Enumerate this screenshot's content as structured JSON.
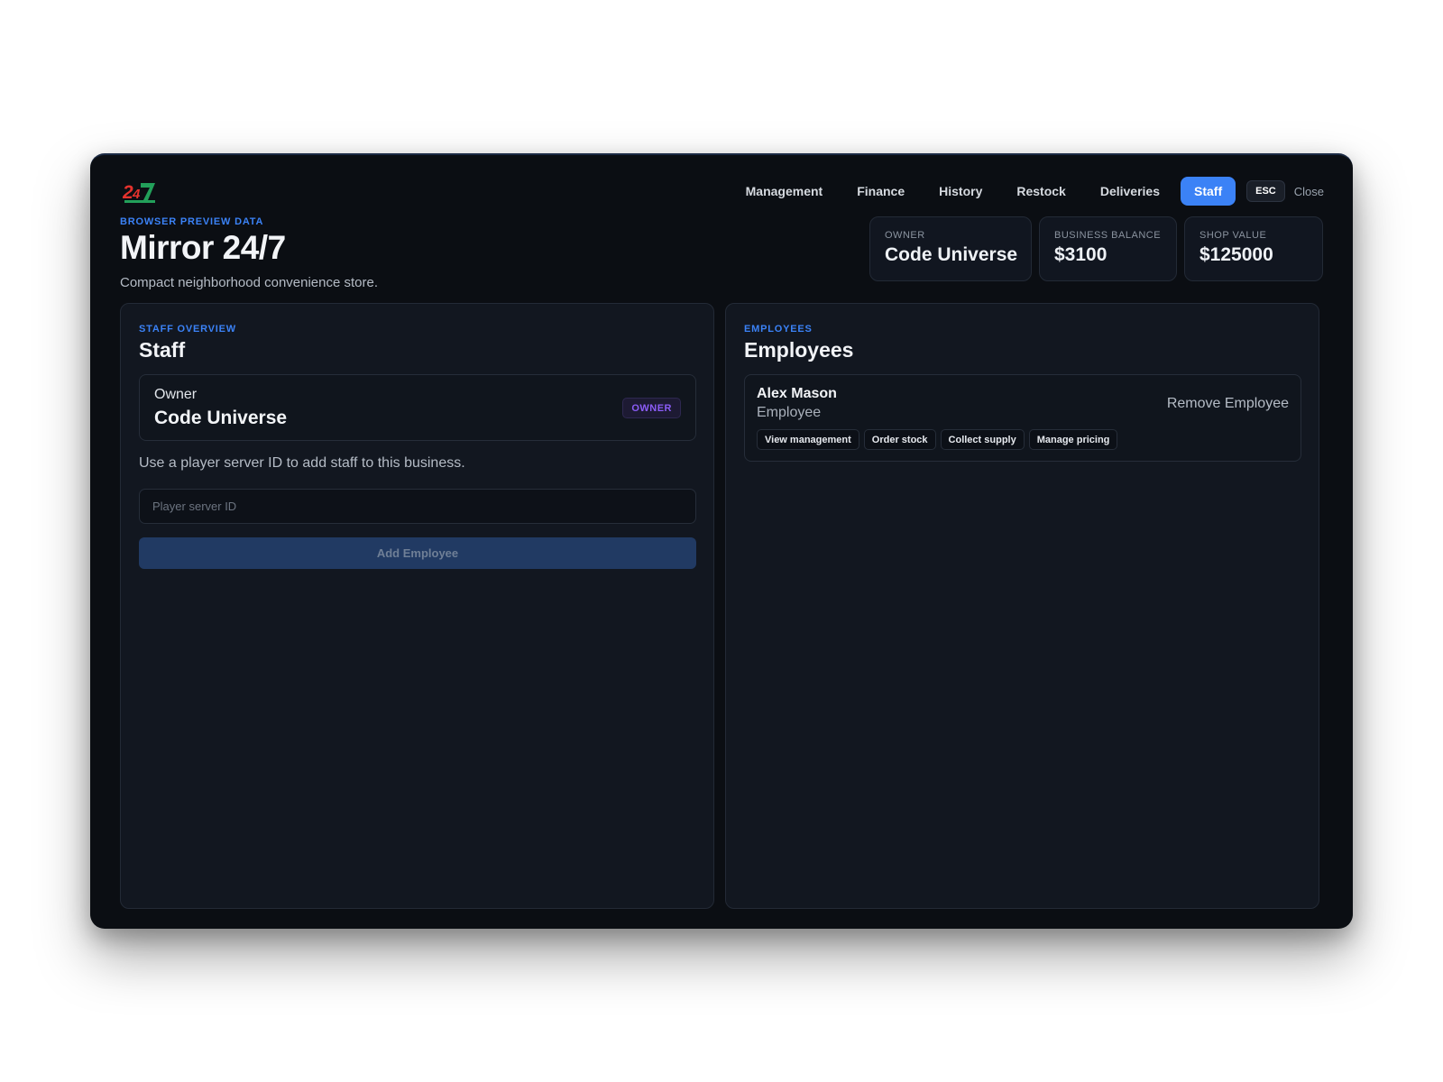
{
  "nav": {
    "tabs": [
      {
        "label": "Management",
        "active": false
      },
      {
        "label": "Finance",
        "active": false
      },
      {
        "label": "History",
        "active": false
      },
      {
        "label": "Restock",
        "active": false
      },
      {
        "label": "Deliveries",
        "active": false
      },
      {
        "label": "Staff",
        "active": true
      }
    ],
    "esc_label": "ESC",
    "close_label": "Close"
  },
  "header": {
    "eyebrow": "BROWSER PREVIEW DATA",
    "title": "Mirror 24/7",
    "subtitle": "Compact neighborhood convenience store."
  },
  "stats": {
    "owner": {
      "label": "OWNER",
      "value": "Code Universe"
    },
    "balance": {
      "label": "BUSINESS BALANCE",
      "value": "$3100"
    },
    "shop_value": {
      "label": "SHOP VALUE",
      "value": "$125000"
    }
  },
  "staff_panel": {
    "eyebrow": "STAFF OVERVIEW",
    "title": "Staff",
    "owner_card": {
      "role": "Owner",
      "name": "Code Universe",
      "badge": "OWNER"
    },
    "helper_text": "Use a player server ID to add staff to this business.",
    "input_placeholder": "Player server ID",
    "input_value": "",
    "add_button_label": "Add Employee"
  },
  "employees_panel": {
    "eyebrow": "EMPLOYEES",
    "title": "Employees",
    "employees": [
      {
        "name": "Alex Mason",
        "role": "Employee",
        "remove_label": "Remove Employee",
        "permissions": [
          "View management",
          "Order stock",
          "Collect supply",
          "Manage pricing"
        ]
      }
    ]
  },
  "colors": {
    "accent": "#3b82f6",
    "window_bg": "#0b0e13",
    "panel_bg": "#121720",
    "owner_badge": "#8b5cf6",
    "logo_red": "#e5322d",
    "logo_green": "#22a05a"
  },
  "icons": {
    "logo": "24-7-logo-icon"
  }
}
